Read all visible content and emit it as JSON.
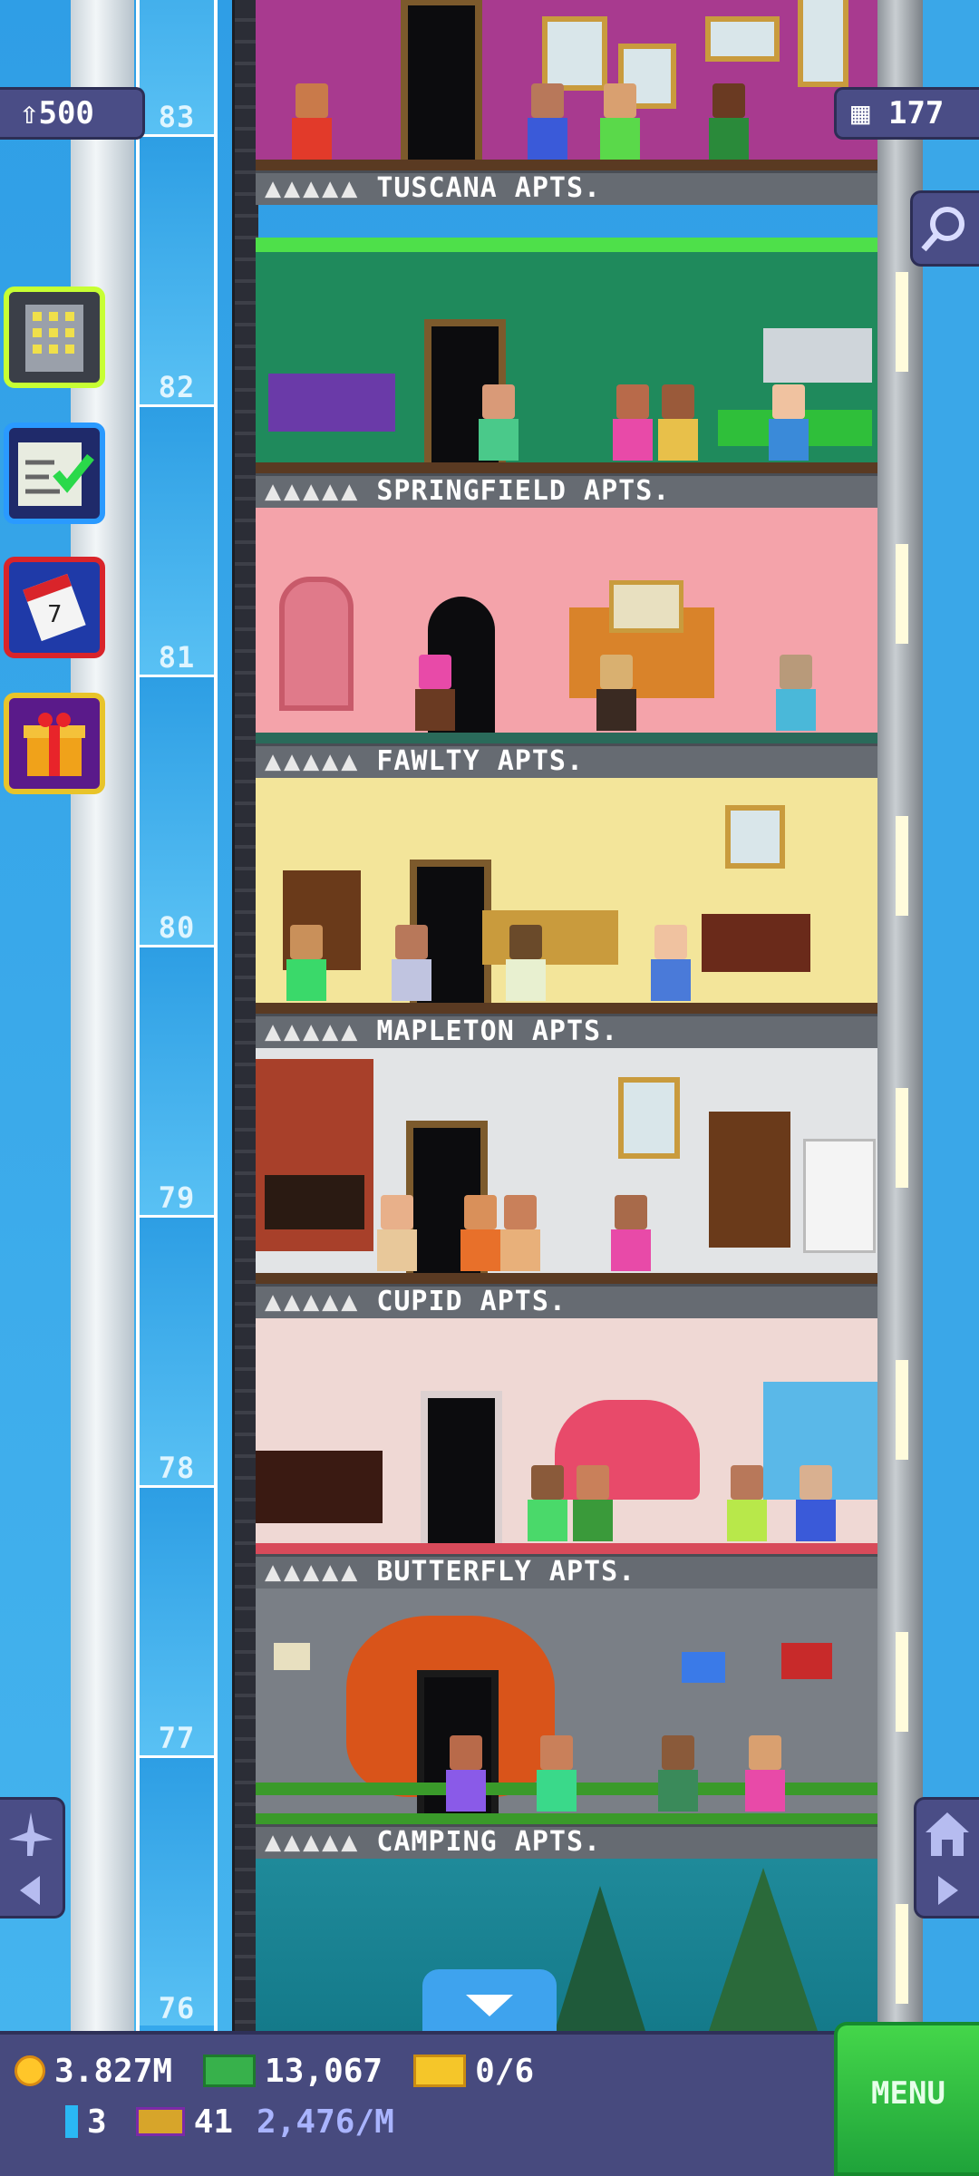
{
  "hud_top": {
    "population": "500",
    "bitizens_icon": "person-icon",
    "stories": "177",
    "stories_icon": "floors-icon"
  },
  "floors": [
    {
      "number": "83",
      "name": "TUSCANA APTS.",
      "stars": "▲▲▲▲▲"
    },
    {
      "number": "82",
      "name": "SPRINGFIELD APTS.",
      "stars": "▲▲▲▲▲"
    },
    {
      "number": "81",
      "name": "FAWLTY APTS.",
      "stars": "▲▲▲▲▲"
    },
    {
      "number": "80",
      "name": "MAPLETON APTS.",
      "stars": "▲▲▲▲▲"
    },
    {
      "number": "79",
      "name": "CUPID APTS.",
      "stars": "▲▲▲▲▲"
    },
    {
      "number": "78",
      "name": "BUTTERFLY APTS.",
      "stars": "▲▲▲▲▲"
    },
    {
      "number": "77",
      "name": "CAMPING APTS.",
      "stars": "▲▲▲▲▲"
    },
    {
      "number": "76",
      "name": "",
      "stars": ""
    }
  ],
  "side_buttons": [
    "build-floor-icon",
    "missions-icon",
    "calendar-icon",
    "gift-icon"
  ],
  "hud_bottom": {
    "coins": "3.827M",
    "cash": "13,067",
    "tickets": "0/6",
    "bux_count": "3",
    "vip_count": "41",
    "income_rate": "2,476/M",
    "menu_label": "MENU"
  },
  "colors": {
    "sky": "#3aa7e8",
    "hud": "#474a7e",
    "menu": "#2fc043",
    "label_bar": "#666b72"
  }
}
